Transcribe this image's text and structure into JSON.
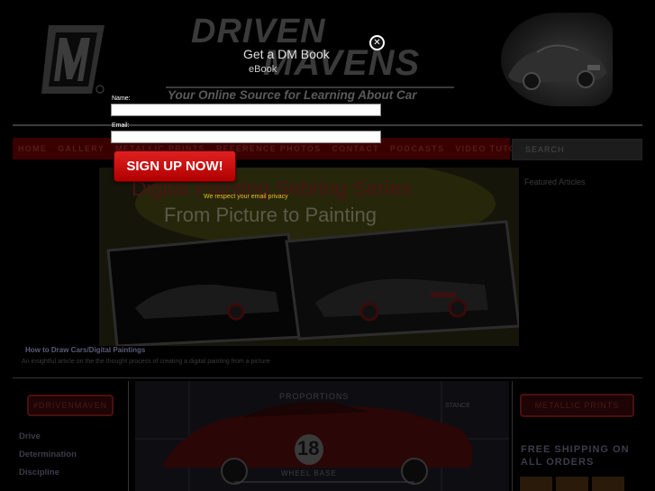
{
  "brand": {
    "line1": "DRIVEN",
    "line2": "MAVENS",
    "tagline": "Your Online Source for Learning About Car Design!"
  },
  "nav": {
    "items": [
      "HOME",
      "GALLERY",
      "METALLIC PRINTS",
      "REFERENCE PHOTOS",
      "CONTACT",
      "PODCASTS",
      "VIDEO TUTORIALS"
    ],
    "search_placeholder": "SEARCH"
  },
  "sidebar_right": {
    "featured_label": "Featured Articles",
    "metallic_badge": "METALLIC PRINTS",
    "free_shipping": "FREE SHIPPING ON ALL ORDERS"
  },
  "hero": {
    "title_line1": "Digital Painting Sebring Series",
    "title_line2": "From Picture to Painting",
    "caption_title": "How to Draw Cars/Digital Paintings",
    "caption_text": "An insightful article on the the thought process of creating a digital painting from a picture"
  },
  "sidebar_left": {
    "badge": "#DRIVENMAVEN",
    "categories": [
      "Drive",
      "Determination",
      "Discipline"
    ]
  },
  "center_art": {
    "label_top": "PROPORTIONS",
    "label_base": "WHEEL BASE",
    "car_number": "18",
    "label_right": "STANCE"
  },
  "modal": {
    "title": "Get a DM Book",
    "subtitle": "eBook",
    "name_label": "Name:",
    "email_label": "Email:",
    "signup_label": "SIGN UP NOW!",
    "privacy_text": "We respect your email privacy",
    "close_glyph": "✕"
  },
  "colors": {
    "nav_bg": "#3a0000",
    "signup_red": "#d01010",
    "privacy_yellow": "#e6c02a"
  }
}
